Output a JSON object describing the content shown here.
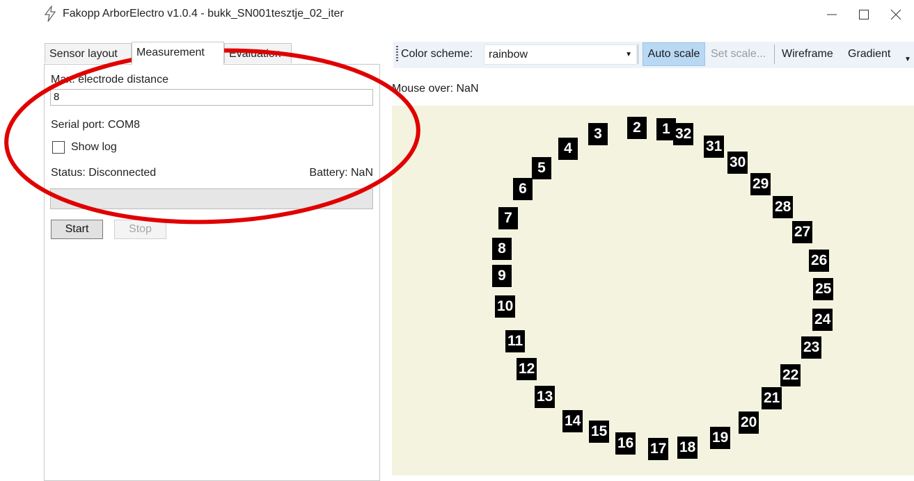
{
  "window": {
    "title": "Fakopp ArborElectro v1.0.4 - bukk_SN001tesztje_02_iter",
    "icon": "lightning-icon",
    "controls": [
      "minimize-icon",
      "maximize-icon",
      "close-icon"
    ]
  },
  "tabs": [
    {
      "label": "Sensor layout",
      "active": false
    },
    {
      "label": "Measurement",
      "active": true
    },
    {
      "label": "Evaluation",
      "active": false
    }
  ],
  "measurement": {
    "max_electrode_distance_label": "Max. electrode distance",
    "max_electrode_distance_value": "8",
    "serial_port": "Serial port: COM8",
    "show_log_label": "Show log",
    "show_log_checked": false,
    "status": "Status: Disconnected",
    "battery": "Battery: NaN",
    "progress": 0,
    "start_label": "Start",
    "stop_label": "Stop"
  },
  "toolbar": {
    "color_scheme_label": "Color scheme:",
    "color_scheme_value": "rainbow",
    "auto_scale": "Auto scale",
    "set_scale": "Set scale...",
    "wireframe": "Wireframe",
    "gradient": "Gradient"
  },
  "mouse_over": "Mouse over: NaN",
  "sensors": [
    "1",
    "2",
    "3",
    "4",
    "5",
    "6",
    "7",
    "8",
    "9",
    "10",
    "11",
    "12",
    "13",
    "14",
    "15",
    "16",
    "17",
    "18",
    "19",
    "20",
    "21",
    "22",
    "23",
    "24",
    "25",
    "26",
    "27",
    "28",
    "29",
    "30",
    "31",
    "32"
  ],
  "colors": {
    "annotation": "#e00000",
    "canvas_bg": "#f4f3df",
    "toolbar_bg": "#eef3fa",
    "auto_scale_bg": "#b9d8f3"
  }
}
